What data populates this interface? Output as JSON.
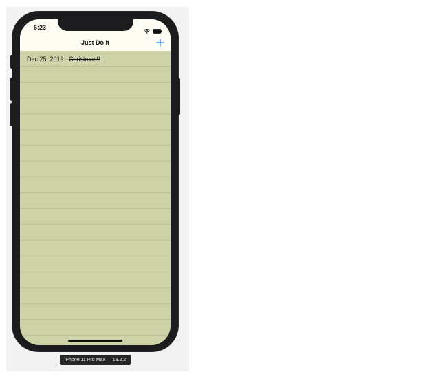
{
  "status_bar": {
    "time": "6:23",
    "icons": [
      "wifi-icon",
      "battery-icon"
    ]
  },
  "nav": {
    "title": "Just Do It",
    "add_icon": "plus-icon",
    "accent_color": "#1a7ef2"
  },
  "list": {
    "background_color": "#cdd3a7",
    "items": [
      {
        "date": "Dec 25, 2019",
        "text": "Christmas!!",
        "completed": true
      }
    ]
  },
  "device_label": "iPhone 11 Pro Max — 13.2.2"
}
